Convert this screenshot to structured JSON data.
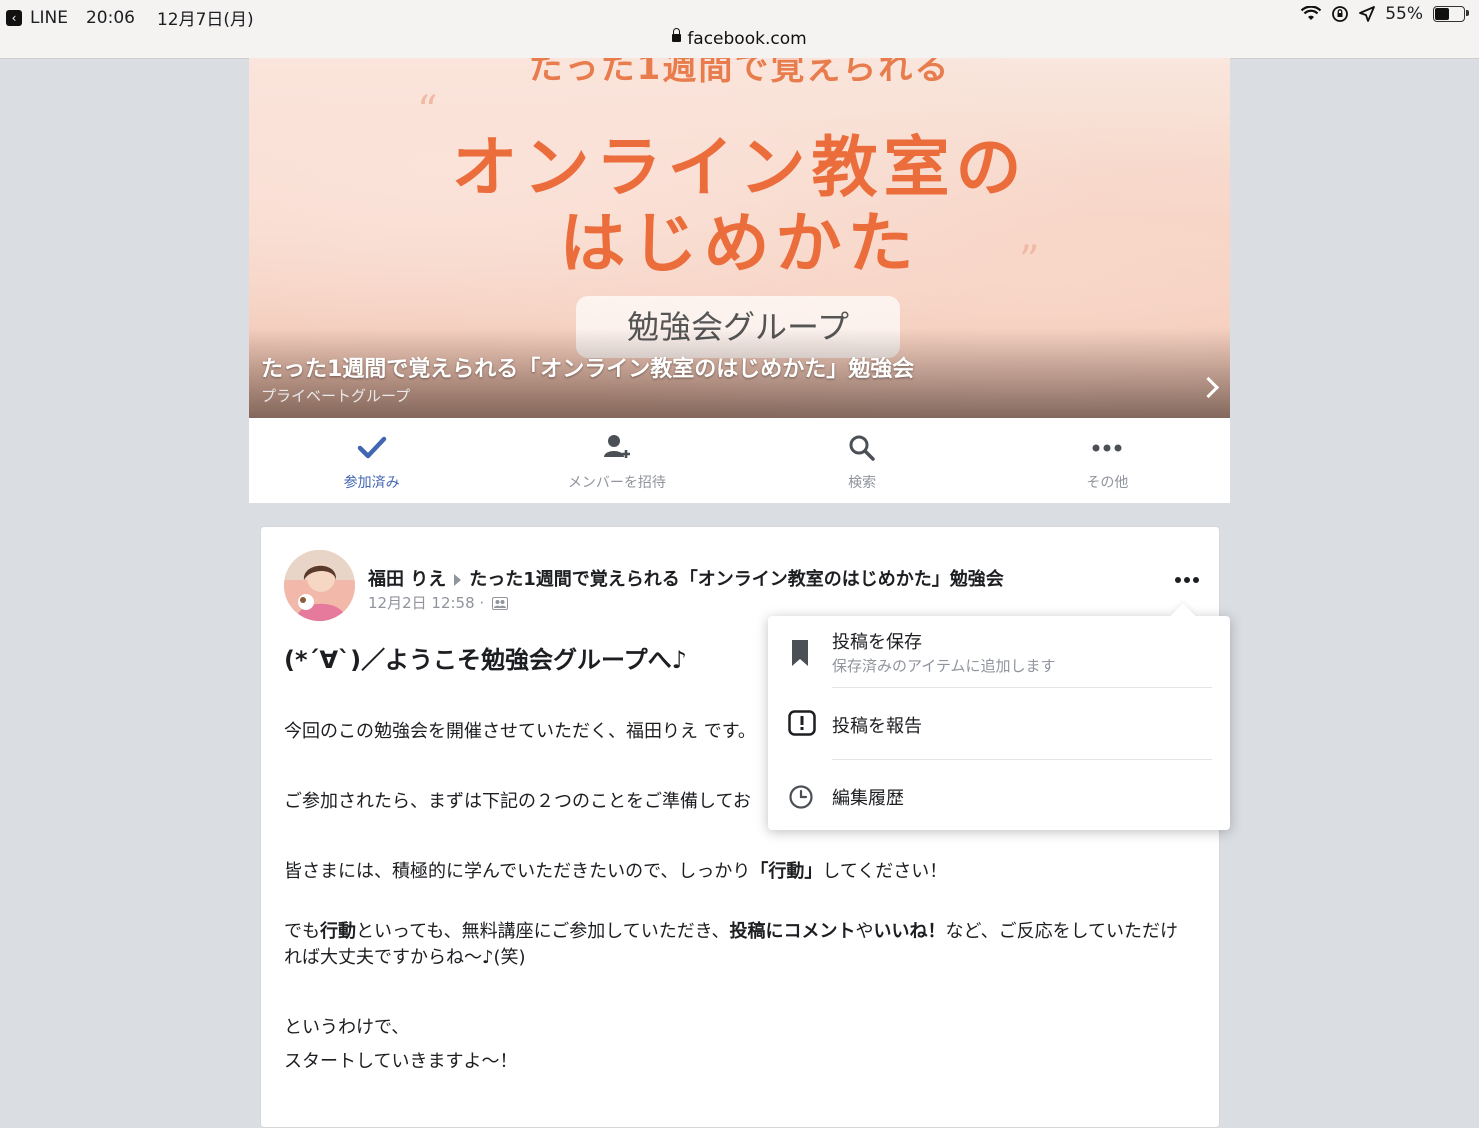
{
  "status_bar": {
    "back_app": "LINE",
    "time": "20:06",
    "date": "12月7日(月)",
    "url": "facebook.com",
    "battery": "55%",
    "battery_level": 0.55
  },
  "cover": {
    "top_text": "たった1週間で覚えられる",
    "title_line1": "オンライン教室の",
    "title_line2": "はじめかた",
    "badge": "勉強会グループ",
    "group_name": "たった1週間で覚えられる「オンライン教室のはじめかた」勉強会",
    "group_type": "プライベートグループ"
  },
  "tabs": [
    {
      "label": "参加済み",
      "icon": "check-icon",
      "active": true
    },
    {
      "label": "メンバーを招待",
      "icon": "add-person-icon"
    },
    {
      "label": "検索",
      "icon": "search-icon"
    },
    {
      "label": "その他",
      "icon": "more-icon"
    }
  ],
  "post": {
    "author": "福田 りえ",
    "group": "たった1週間で覚えられる「オンライン教室のはじめかた」勉強会",
    "timestamp": "12月2日 12:58 ·",
    "headline": "(*´∀`)／ようこそ勉強会グループへ♪",
    "p1": "今回のこの勉強会を開催させていただく、福田りえ です。",
    "p2": "ご参加されたら、まずは下記の２つのことをご準備してお",
    "p3_a": "皆さまには、積極的に学んでいただきたいので、しっかり",
    "p3_b": "「行動」",
    "p3_c": "してください！",
    "p4_a": "でも",
    "p4_b": "行動",
    "p4_c": "といっても、無料講座にご参加していただき、",
    "p4_d": "投稿にコメント",
    "p4_e": "や",
    "p4_f": "いいね！",
    "p4_g": "など、ご反応をしていただければ大丈夫ですからね〜♪(笑)",
    "p5": "というわけで、",
    "p6": "スタートしていきますよ〜！"
  },
  "menu": {
    "save_title": "投稿を保存",
    "save_sub": "保存済みのアイテムに追加します",
    "report_title": "投稿を報告",
    "history_title": "編集履歴"
  },
  "colors": {
    "accent": "#4267b2",
    "cover_title": "#ec6d3c",
    "muted": "#90949c",
    "background": "#dadde2"
  }
}
